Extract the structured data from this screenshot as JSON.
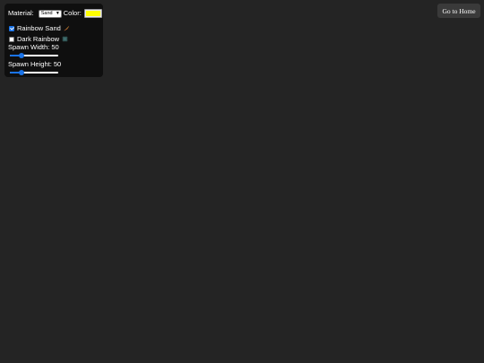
{
  "panel": {
    "material_label": "Material:",
    "material_selected": "Sand",
    "color_label": "Color:",
    "color_value": "#ffff00",
    "rainbow_sand": {
      "label": "Rainbow Sand",
      "checked": true,
      "emoji_icon": "rainbow-feather-icon"
    },
    "dark_rainbow": {
      "label": "Dark Rainbow",
      "checked": false,
      "emoji_icon": "dark-square-icon"
    },
    "spawn_width": {
      "label": "Spawn Width: 50",
      "value": 50,
      "min": 1,
      "max": 200
    },
    "spawn_height": {
      "label": "Spawn Height: 50",
      "value": 50,
      "min": 1,
      "max": 200
    }
  },
  "home_button": {
    "label": "Go to Home"
  },
  "colors": {
    "background": "#242424",
    "panel": "#0f0f0f",
    "accent": "#1a73e8",
    "button": "#3a3a3a"
  }
}
